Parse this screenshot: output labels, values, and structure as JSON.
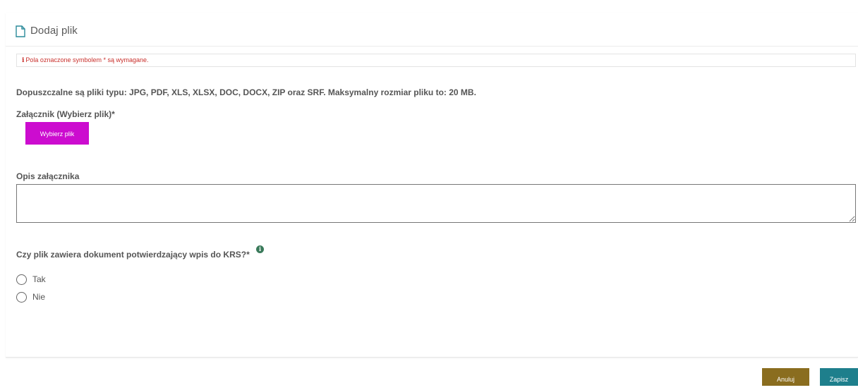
{
  "header": {
    "icon": "document-icon",
    "title": "Dodaj plik"
  },
  "required_note": {
    "icon": "info-icon",
    "text": "Pola oznaczone symbolem * są wymagane."
  },
  "form": {
    "allowed_files_text": "Dopuszczalne są pliki typu: JPG, PDF, XLS, XLSX, DOC, DOCX, ZIP oraz SRF. Maksymalny rozmiar pliku to: 20 MB.",
    "attachment_label": "Załącznik (Wybierz plik)*",
    "file_button_label": "Wybierz plik",
    "description_label": "Opis załącznika",
    "description_value": "",
    "krs_question": "Czy plik zawiera dokument potwierdzający wpis do KRS?*",
    "krs_info_icon": "info-circle-icon",
    "krs_options": [
      {
        "label": "Tak",
        "checked": false
      },
      {
        "label": "Nie",
        "checked": false
      }
    ]
  },
  "footer": {
    "cancel_label": "Anuluj",
    "save_label": "Zapisz"
  },
  "colors": {
    "file_button": "#cc0ccf",
    "cancel_button": "#8a6d1f",
    "save_button": "#1e7f8c",
    "required_text": "#c9302c",
    "info_icon": "#3a7a5a"
  }
}
